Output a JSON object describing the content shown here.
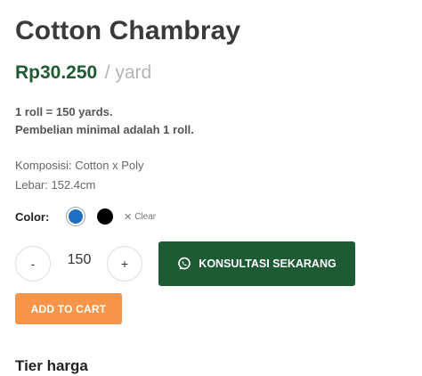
{
  "product": {
    "title": "Cotton Chambray",
    "price": "Rp30.250",
    "unit": "/ yard",
    "note_line1": "1 roll = 150 yards.",
    "note_line2": "Pembelian minimal adalah 1 roll.",
    "composition": "Komposisi: Cotton x Poly",
    "width": "Lebar: 152.4cm"
  },
  "color": {
    "label": "Color:",
    "options": [
      {
        "name": "blue",
        "hex": "#1f6fc4",
        "selected": true
      },
      {
        "name": "black",
        "hex": "#000000",
        "selected": false
      }
    ],
    "clear_label": "Clear"
  },
  "quantity": {
    "minus_label": "-",
    "value": "150",
    "plus_label": "+"
  },
  "actions": {
    "consult_label": "KONSULTASI SEKARANG",
    "consult_icon": "whatsapp-icon",
    "add_to_cart_label": "ADD TO CART"
  },
  "tier": {
    "heading": "Tier harga"
  },
  "colors": {
    "brand_green": "#1e5a34",
    "cart_orange": "#f7964a"
  }
}
